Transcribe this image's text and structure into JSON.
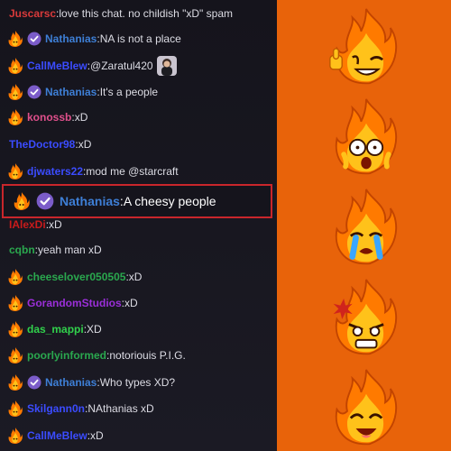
{
  "chat": {
    "messages": [
      {
        "user": "Juscarsc",
        "color": "#d93a3a",
        "text": "love this chat. no childish \"xD\" spam",
        "flame": false,
        "verified": false
      },
      {
        "user": "Nathanias",
        "color": "#3e7fd6",
        "text": "NA is not a place",
        "flame": true,
        "verified": true
      },
      {
        "user": "CallMeBlew",
        "color": "#3b4cff",
        "text": "@Zaratul420",
        "flame": true,
        "verified": false,
        "avatar": true
      },
      {
        "user": "Nathanias",
        "color": "#3e7fd6",
        "text": "It's a people",
        "flame": true,
        "verified": true
      },
      {
        "user": "konossb",
        "color": "#e0508c",
        "text": "xD",
        "flame": true,
        "verified": false
      },
      {
        "user": "TheDoctor98",
        "color": "#3b4cff",
        "text": "xD",
        "flame": false,
        "verified": false
      },
      {
        "user": "djwaters22",
        "color": "#3b4cff",
        "text": "mod me @starcraft",
        "flame": true,
        "verified": false
      },
      {
        "user": "IAlexDi",
        "color": "#c91b1b",
        "text": "xD",
        "flame": false,
        "verified": false
      },
      {
        "user": "cqbn",
        "color": "#2aa84e",
        "text": "yeah man xD",
        "flame": false,
        "verified": false
      },
      {
        "user": "cheeselover050505",
        "color": "#2aa84e",
        "text": "xD",
        "flame": true,
        "verified": false
      },
      {
        "user": "GorandomStudios",
        "color": "#9b2fd9",
        "text": "xD",
        "flame": true,
        "verified": false
      },
      {
        "user": "das_mappi",
        "color": "#31d14c",
        "text": "XD",
        "flame": true,
        "verified": false
      },
      {
        "user": "poorlyinformed",
        "color": "#2aa84e",
        "text": "notoriouis P.I.G.",
        "flame": true,
        "verified": false
      },
      {
        "user": "Nathanias",
        "color": "#3e7fd6",
        "text": "Who types XD?",
        "flame": true,
        "verified": true
      },
      {
        "user": "Skilgann0n",
        "color": "#3b4cff",
        "text": "NAthanias xD",
        "flame": true,
        "verified": false
      },
      {
        "user": "CallMeBlew",
        "color": "#3b4cff",
        "text": "xD",
        "flame": true,
        "verified": false
      }
    ],
    "highlight": {
      "user": "Nathanias",
      "color": "#3e7fd6",
      "text": "A cheesy people"
    }
  },
  "stickers": [
    {
      "name": "flame-thumbs-up-wink-sticker"
    },
    {
      "name": "flame-shocked-sticker"
    },
    {
      "name": "flame-crying-sticker"
    },
    {
      "name": "flame-angry-sticker"
    },
    {
      "name": "flame-happy-sticker"
    }
  ]
}
